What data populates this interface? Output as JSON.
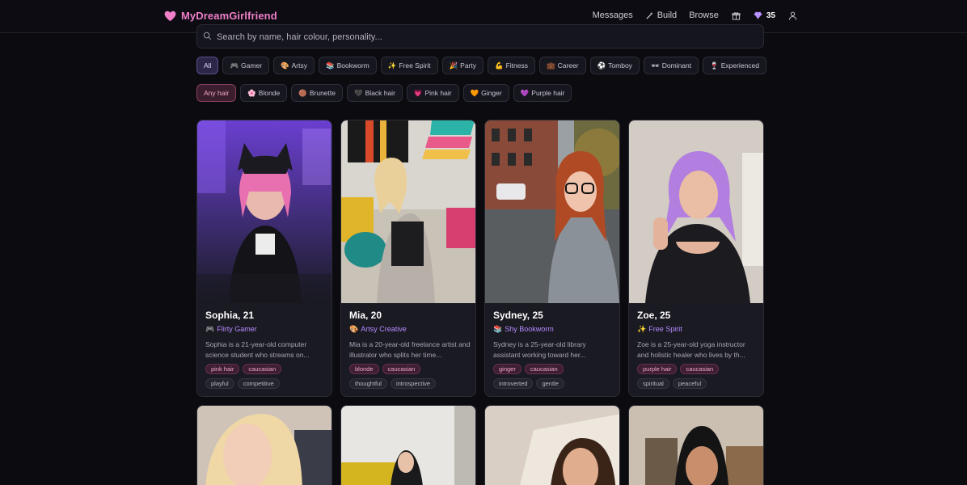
{
  "brand": {
    "name": "MyDreamGirlfriend"
  },
  "nav": {
    "messages": "Messages",
    "build": "Build",
    "browse": "Browse",
    "gems": "35"
  },
  "search": {
    "placeholder": "Search by name, hair colour, personality..."
  },
  "filters": [
    {
      "label": "All",
      "emoji": "",
      "active": true
    },
    {
      "label": "Gamer",
      "emoji": "🎮"
    },
    {
      "label": "Artsy",
      "emoji": "🎨"
    },
    {
      "label": "Bookworm",
      "emoji": "📚"
    },
    {
      "label": "Free Spirit",
      "emoji": "✨"
    },
    {
      "label": "Party",
      "emoji": "🎉"
    },
    {
      "label": "Fitness",
      "emoji": "💪"
    },
    {
      "label": "Career",
      "emoji": "💼"
    },
    {
      "label": "Tomboy",
      "emoji": "⚽"
    },
    {
      "label": "Dominant",
      "emoji": "🕶"
    },
    {
      "label": "Experienced",
      "emoji": "🍷"
    }
  ],
  "hair_filters": [
    {
      "label": "Any hair",
      "emoji": "",
      "active": true
    },
    {
      "label": "Blonde",
      "emoji": "🌸"
    },
    {
      "label": "Brunette",
      "emoji": "🟤"
    },
    {
      "label": "Black hair",
      "emoji": "🖤"
    },
    {
      "label": "Pink hair",
      "emoji": "💗"
    },
    {
      "label": "Ginger",
      "emoji": "🧡"
    },
    {
      "label": "Purple hair",
      "emoji": "💜"
    }
  ],
  "cards": [
    {
      "name": "Sophia, 21",
      "archetype": "Flirty Gamer",
      "arch_emoji": "🎮",
      "desc": "Sophia is a 21-year-old computer science student who streams on...",
      "tags": [
        "pink hair",
        "caucasian"
      ],
      "traits": [
        "playful",
        "competitive"
      ]
    },
    {
      "name": "Mia, 20",
      "archetype": "Artsy Creative",
      "arch_emoji": "🎨",
      "desc": "Mia is a 20-year-old freelance artist and illustrator who splits her time...",
      "tags": [
        "blonde",
        "caucasian"
      ],
      "traits": [
        "thoughtful",
        "introspective"
      ]
    },
    {
      "name": "Sydney, 25",
      "archetype": "Shy Bookworm",
      "arch_emoji": "📚",
      "desc": "Sydney is a 25-year-old library assistant working toward her...",
      "tags": [
        "ginger",
        "caucasian"
      ],
      "traits": [
        "introverted",
        "gentle"
      ]
    },
    {
      "name": "Zoe, 25",
      "archetype": "Free Spirit",
      "arch_emoji": "✨",
      "desc": "Zoe is a 25-year-old yoga instructor and holistic healer who lives by th...",
      "tags": [
        "purple hair",
        "caucasian"
      ],
      "traits": [
        "spiritual",
        "peaceful"
      ]
    }
  ],
  "colors": {
    "accent_pink": "#f07fc9",
    "accent_violet": "#b48bff",
    "bg": "#0b0b10",
    "card": "#1a1a22"
  }
}
